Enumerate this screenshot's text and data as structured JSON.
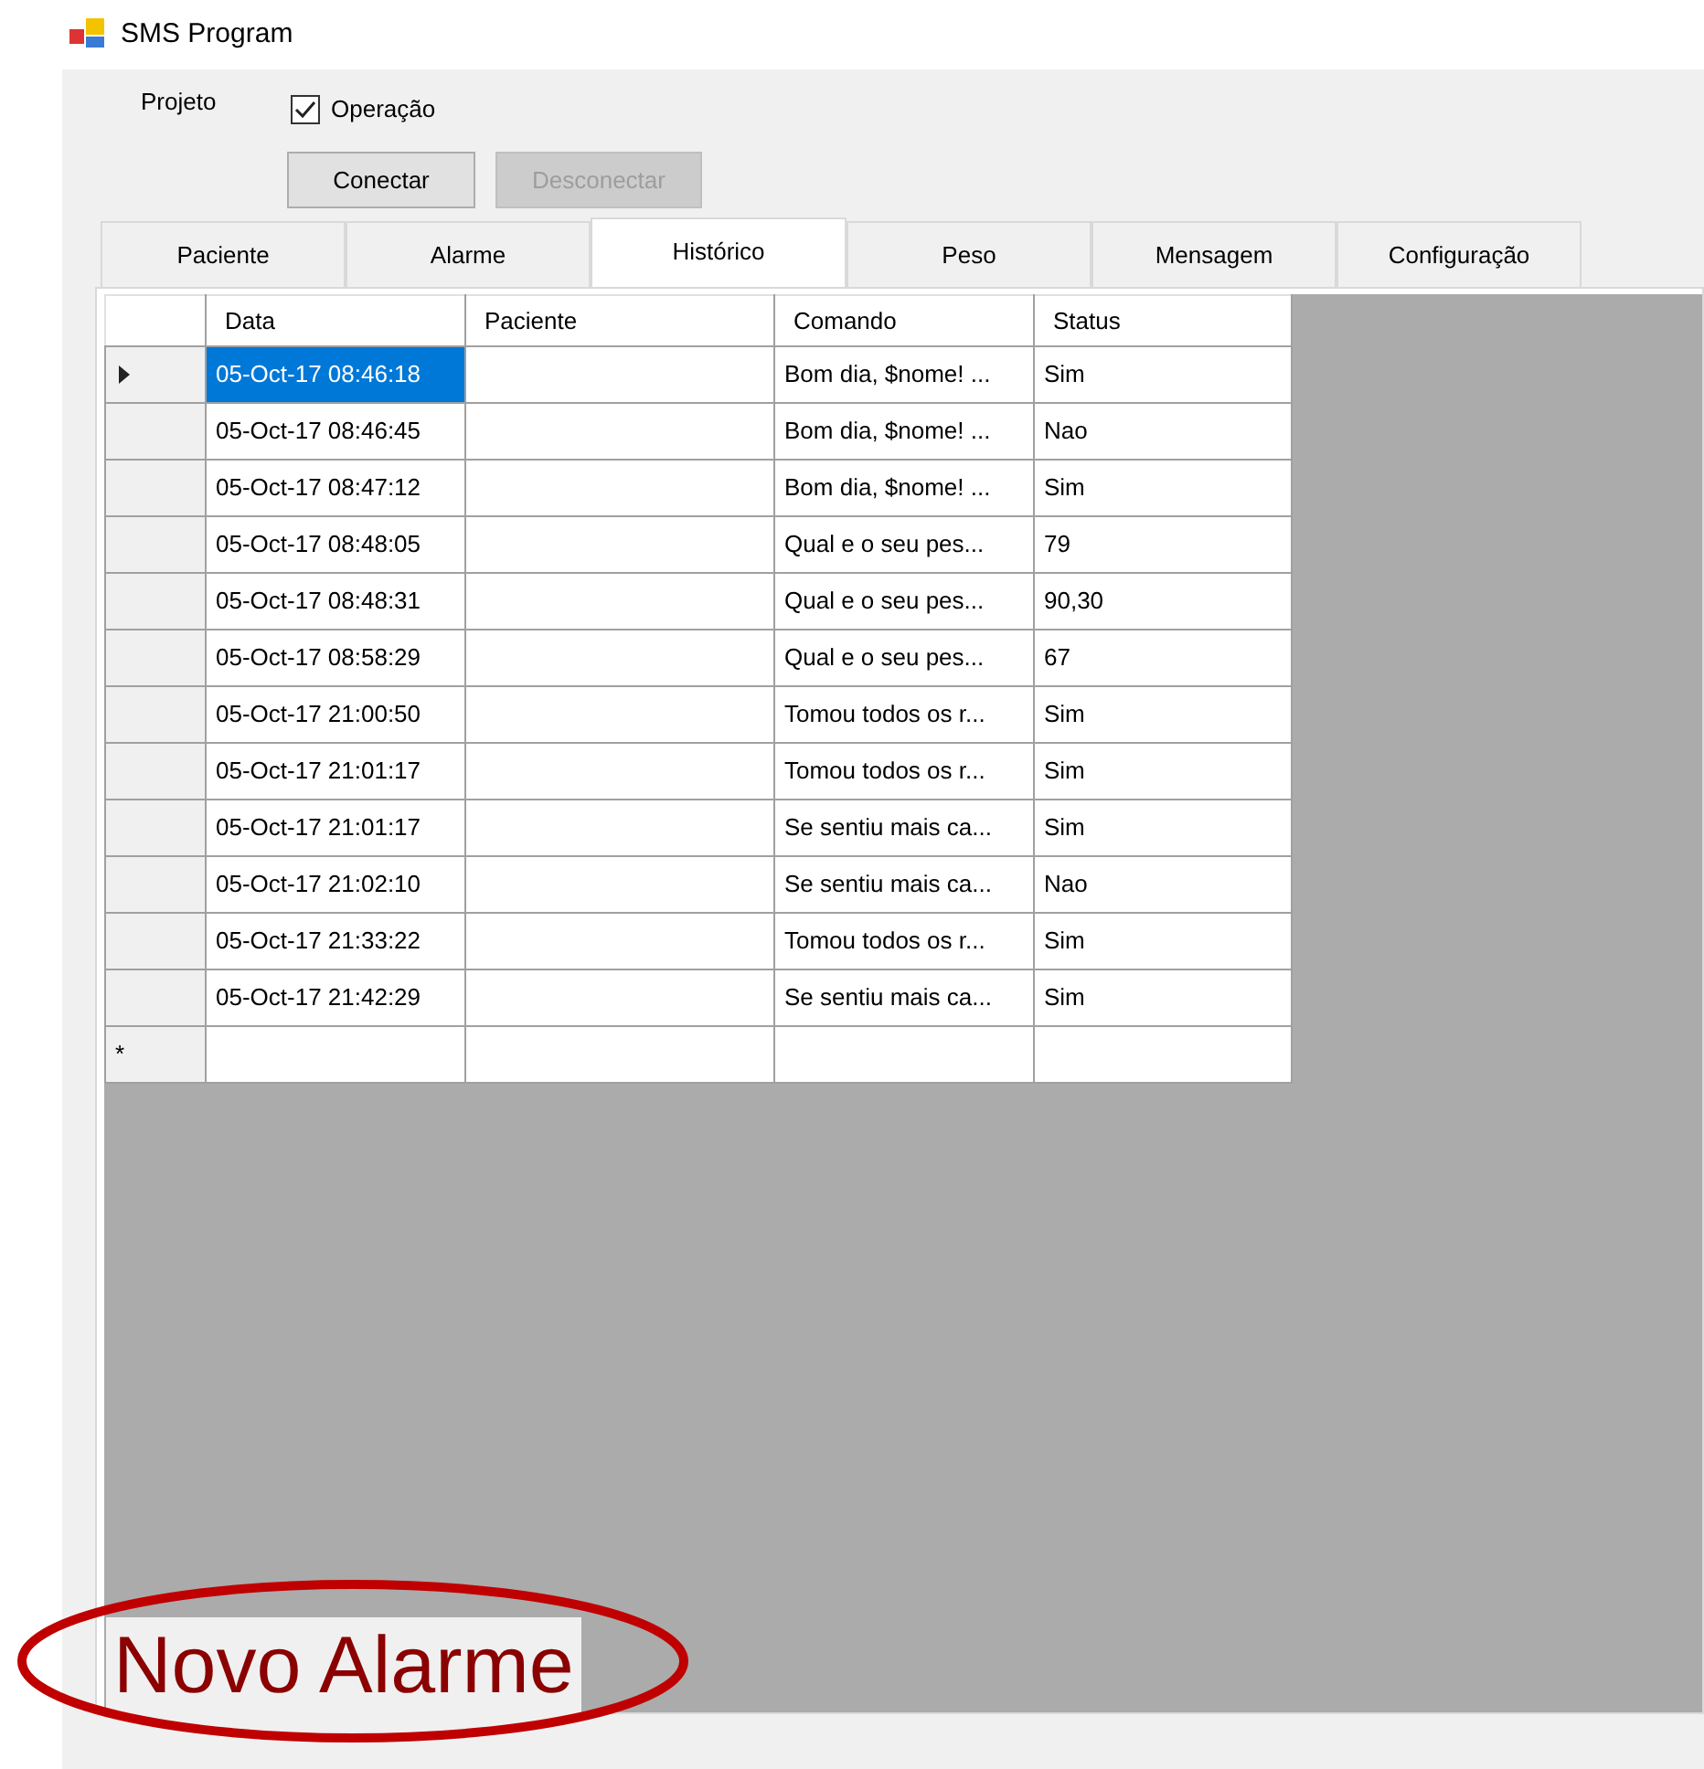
{
  "window": {
    "title": "SMS Program"
  },
  "project_label": "Projeto",
  "checkbox": {
    "label": "Operação",
    "checked": true
  },
  "buttons": [
    {
      "label": "Conectar",
      "disabled": false
    },
    {
      "label": "Desconectar",
      "disabled": true
    }
  ],
  "tabs": [
    {
      "label": "Paciente",
      "selected": false
    },
    {
      "label": "Alarme",
      "selected": false
    },
    {
      "label": "Histórico",
      "selected": true
    },
    {
      "label": "Peso",
      "selected": false
    },
    {
      "label": "Mensagem",
      "selected": false
    },
    {
      "label": "Configuração",
      "selected": false
    }
  ],
  "grid": {
    "columns": [
      "Data",
      "Paciente",
      "Comando",
      "Status"
    ],
    "rows": [
      {
        "current": true,
        "data": "05-Oct-17 08:46:18",
        "data_selected": true,
        "comando": "Bom dia, $nome! ...",
        "status": "Sim"
      },
      {
        "current": false,
        "data": "05-Oct-17 08:46:45",
        "data_selected": false,
        "comando": "Bom dia, $nome! ...",
        "status": "Nao"
      },
      {
        "current": false,
        "data": "05-Oct-17 08:47:12",
        "data_selected": false,
        "comando": "Bom dia, $nome! ...",
        "status": "Sim"
      },
      {
        "current": false,
        "data": "05-Oct-17 08:48:05",
        "data_selected": false,
        "comando": "Qual e o seu pes...",
        "status": "79"
      },
      {
        "current": false,
        "data": "05-Oct-17 08:48:31",
        "data_selected": false,
        "comando": "Qual e o seu pes...",
        "status": "90,30"
      },
      {
        "current": false,
        "data": "05-Oct-17 08:58:29",
        "data_selected": false,
        "comando": "Qual e o seu pes...",
        "status": "67"
      },
      {
        "current": false,
        "data": "05-Oct-17 21:00:50",
        "data_selected": false,
        "comando": "Tomou todos os r...",
        "status": "Sim"
      },
      {
        "current": false,
        "data": "05-Oct-17 21:01:17",
        "data_selected": false,
        "comando": "Tomou todos os r...",
        "status": "Sim"
      },
      {
        "current": false,
        "data": "05-Oct-17 21:01:17",
        "data_selected": false,
        "comando": "Se sentiu mais ca...",
        "status": "Sim"
      },
      {
        "current": false,
        "data": "05-Oct-17 21:02:10",
        "data_selected": false,
        "comando": "Se sentiu mais ca...",
        "status": "Nao"
      },
      {
        "current": false,
        "data": "05-Oct-17 21:33:22",
        "data_selected": false,
        "comando": "Tomou todos os r...",
        "status": "Sim"
      },
      {
        "current": false,
        "data": "05-Oct-17 21:42:29",
        "data_selected": false,
        "comando": "Se sentiu mais ca...",
        "status": "Sim"
      }
    ],
    "new_row_marker": "*"
  },
  "alert_label": "Novo Alarme"
}
